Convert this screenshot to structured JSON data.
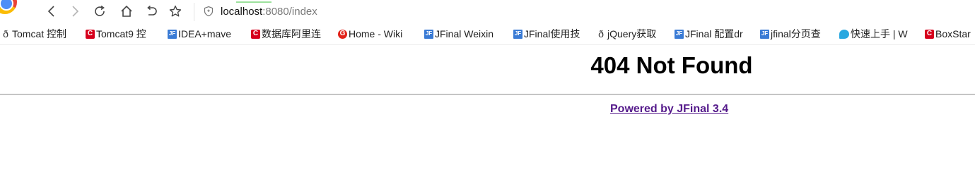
{
  "toolbar": {
    "url_host": "localhost",
    "url_rest": ":8080/index"
  },
  "bookmarks": [
    {
      "icon": "swirl-icon",
      "label": "Tomcat 控制"
    },
    {
      "icon": "red-c-icon",
      "label": "Tomcat9 控"
    },
    {
      "icon": "jfinal-icon",
      "label": "IDEA+mave"
    },
    {
      "icon": "red-c-icon",
      "label": "数据库阿里连"
    },
    {
      "icon": "red-g-icon",
      "label": "Home - Wiki"
    },
    {
      "icon": "jfinal-icon",
      "label": "JFinal Weixin"
    },
    {
      "icon": "jfinal-icon",
      "label": "JFinal使用技"
    },
    {
      "icon": "swirl-icon",
      "label": "jQuery获取"
    },
    {
      "icon": "jfinal-icon",
      "label": "JFinal 配置dr"
    },
    {
      "icon": "jfinal-icon",
      "label": "jfinal分页查"
    },
    {
      "icon": "bird-icon",
      "label": "快速上手 | W"
    },
    {
      "icon": "red-c-icon",
      "label": "BoxStar"
    }
  ],
  "page": {
    "heading": "404 Not Found",
    "footer_link": "Powered by JFinal 3.4"
  },
  "colors": {
    "link": "#551a8b",
    "rule": "#9a9a9a"
  }
}
